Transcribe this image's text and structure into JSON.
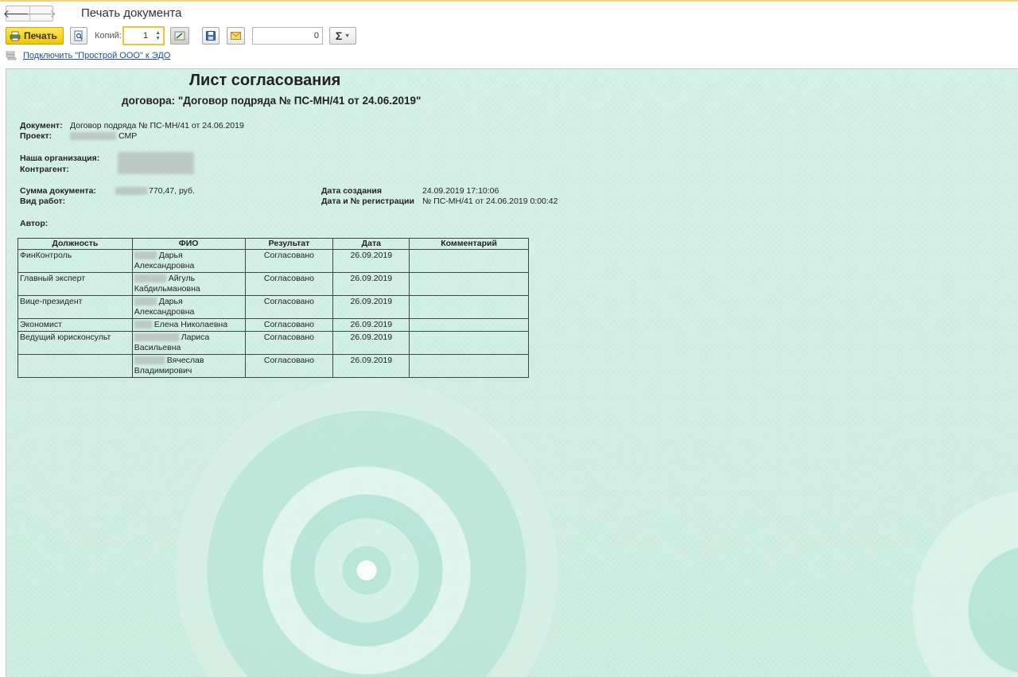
{
  "window": {
    "title": "Печать документа"
  },
  "toolbar": {
    "print_label": "Печать",
    "copies_label": "Копий:",
    "copies_value": "1",
    "sum_value": "0",
    "sum_icon": "Σ"
  },
  "edo": {
    "link_text": "Подключить \"Прострой ООО\" к ЭДО"
  },
  "document": {
    "title": "Лист согласования",
    "subtitle": "договора:  \"Договор подряда № ПС-МН/41 от 24.06.2019\"",
    "fields": {
      "document_label": "Документ:",
      "document_value": "Договор подряда № ПС-МН/41 от 24.06.2019",
      "project_label": "Проект:",
      "project_value": "СМР",
      "our_org_label": "Наша организация:",
      "counterparty_label": "Контрагент:",
      "sum_label": "Сумма документа:",
      "sum_value": "770,47, руб.",
      "work_type_label": "Вид работ:",
      "created_label": "Дата создания",
      "created_value": "24.09.2019 17:10:06",
      "reg_label": "Дата и № регистрации",
      "reg_value": "№ ПС-МН/41 от 24.06.2019 0:00:42",
      "author_label": "Автор:"
    },
    "table": {
      "headers": [
        "Должность",
        "ФИО",
        "Результат",
        "Дата",
        "Комментарий"
      ],
      "rows": [
        {
          "position": "ФинКонтроль",
          "fio1": "Дарья",
          "fio2": "Александровна",
          "result": "Согласовано",
          "date": "26.09.2019",
          "comment": ""
        },
        {
          "position": "Главный эксперт",
          "fio1": "Айгуль",
          "fio2": "Кабдильмановна",
          "result": "Согласовано",
          "date": "26.09.2019",
          "comment": ""
        },
        {
          "position": "Вице-президент",
          "fio1": "Дарья",
          "fio2": "Александровна",
          "result": "Согласовано",
          "date": "26.09.2019",
          "comment": ""
        },
        {
          "position": "Экономист",
          "fio1": "Елена Николаевна",
          "fio2": "",
          "result": "Согласовано",
          "date": "26.09.2019",
          "comment": ""
        },
        {
          "position": "Ведущий юрисконсульт",
          "fio1": "Лариса",
          "fio2": "Васильевна",
          "result": "Согласовано",
          "date": "26.09.2019",
          "comment": ""
        },
        {
          "position": "",
          "fio1": "Вячеслав",
          "fio2": "Владимирович",
          "result": "Согласовано",
          "date": "26.09.2019",
          "comment": ""
        }
      ]
    }
  }
}
